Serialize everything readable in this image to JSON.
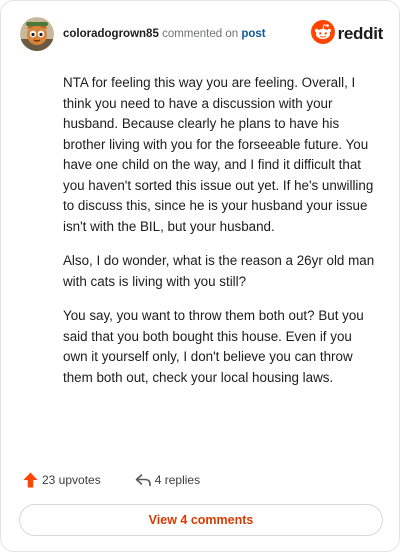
{
  "header": {
    "username": "coloradogrown85",
    "action_text": "commented on",
    "post_link": "post",
    "brand": "reddit",
    "brand_color": "#ff4500"
  },
  "comment": {
    "paragraphs": [
      "NTA for feeling this way you are feeling. Overall, I think you need to have a discussion with your husband. Because clearly he plans to have his brother living with you for the forseeable future. You have one child on the way, and I find it difficult that you haven't sorted this issue out yet. If he's unwilling to discuss this, since he is your husband your issue isn't with the BIL, but your husband.",
      "Also, I do wonder, what is the reason a 26yr old man with cats is living with you still?",
      "You say, you want to throw them both out? But you said that you both bought this house. Even if you own it yourself only, I don't believe you can throw them both out, check your local housing laws."
    ]
  },
  "footer": {
    "upvotes": "23 upvotes",
    "replies": "4 replies",
    "upvote_color": "#ff4500",
    "view_label": "View 4 comments",
    "view_color": "#d93a00"
  }
}
